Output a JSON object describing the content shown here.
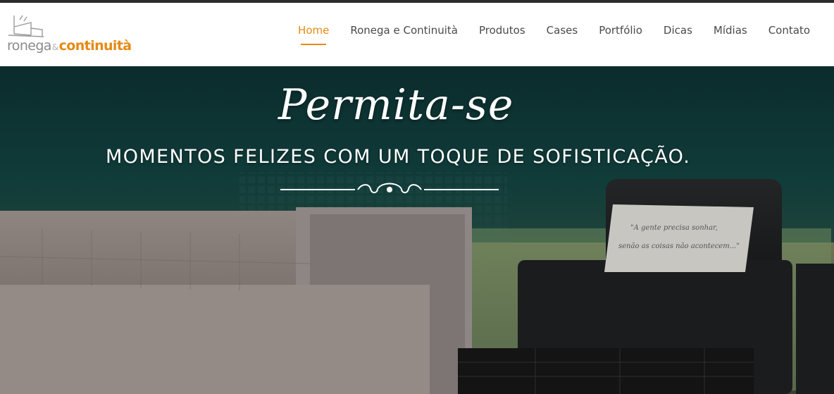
{
  "header": {
    "logo": {
      "word1": "ronega",
      "amp": "&",
      "word2": "continuità"
    },
    "nav": [
      {
        "label": "Home",
        "active": true
      },
      {
        "label": "Ronega e Continuità",
        "active": false
      },
      {
        "label": "Produtos",
        "active": false
      },
      {
        "label": "Cases",
        "active": false
      },
      {
        "label": "Portfólio",
        "active": false
      },
      {
        "label": "Dicas",
        "active": false
      },
      {
        "label": "Mídias",
        "active": false
      },
      {
        "label": "Contato",
        "active": false
      }
    ]
  },
  "hero": {
    "title": "Permita-se",
    "subtitle": "MOMENTOS FELIZES COM UM TOQUE DE SOFISTICAÇÃO.",
    "pillow_text": [
      "\"A gente precisa sonhar,",
      "senão as coisas não acontecem...\""
    ],
    "background": "living-room-sofa-armchair-photo"
  },
  "colors": {
    "accent": "#e58a14",
    "nav_text": "#4a4a4a",
    "topbar": "#2a2a2a",
    "hero_teal": "#12403d"
  }
}
